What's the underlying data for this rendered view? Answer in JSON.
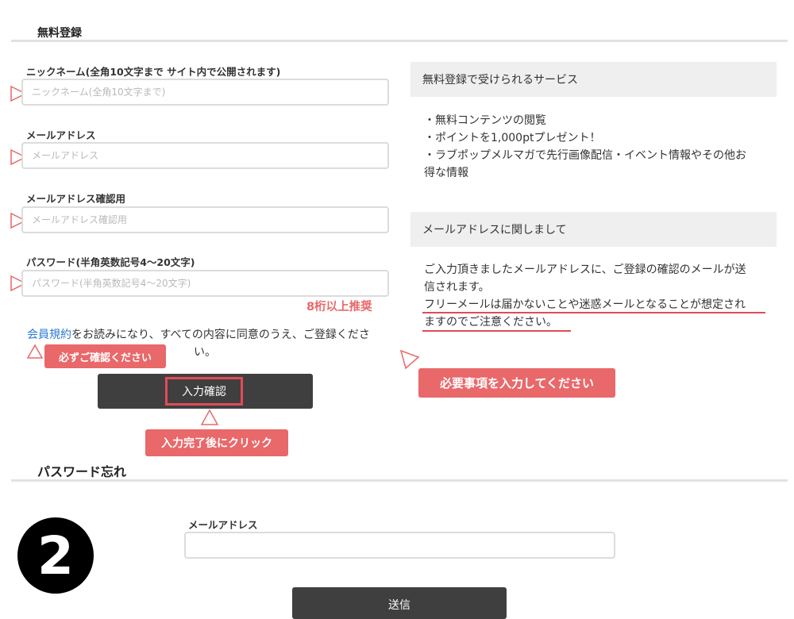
{
  "registration": {
    "title": "無料登録",
    "fields": [
      {
        "label": "ニックネーム(全角10文字まで サイト内で公開されます)",
        "placeholder": "ニックネーム(全角10文字まで)",
        "value": ""
      },
      {
        "label": "メールアドレス",
        "placeholder": "メールアドレス",
        "value": ""
      },
      {
        "label": "メールアドレス確認用",
        "placeholder": "メールアドレス確認用",
        "value": ""
      },
      {
        "label": "パスワード(半角英数記号4〜20文字)",
        "placeholder": "パスワード(半角英数記号4〜20文字)",
        "value": ""
      }
    ],
    "password_hint": "8桁以上推奨",
    "terms_link": "会員規約",
    "terms_text": "をお読みになり、すべての内容に同意のうえ、ご登録くださ",
    "terms_text_end": "い。",
    "confirm_button": "入力確認"
  },
  "annotations": {
    "check_note": "必ずご確認ください",
    "click_note": "入力完了後にクリック",
    "fill_note": "必要事項を入力してください",
    "accent_color": "#e9686a"
  },
  "services_panel": {
    "heading": "無料登録で受けられるサービス",
    "items": [
      "・無料コンテンツの閲覧",
      "・ポイントを1,000ptプレゼント！",
      "・ラブポップメルマガで先行画像配信・イベント情報やその他お",
      "得な情報"
    ]
  },
  "email_panel": {
    "heading": "メールアドレスに関しまして",
    "lines": [
      "ご入力頂きましたメールアドレスに、ご登録の確認のメールが送",
      "信されます。",
      "フリーメールは届かないことや迷惑メールとなることが想定され",
      "ますのでご注意ください。"
    ]
  },
  "password_forgot": {
    "title": "パスワード忘れ",
    "email_label": "メールアドレス",
    "email_value": "",
    "submit_button": "送信"
  },
  "step_badge": "2"
}
